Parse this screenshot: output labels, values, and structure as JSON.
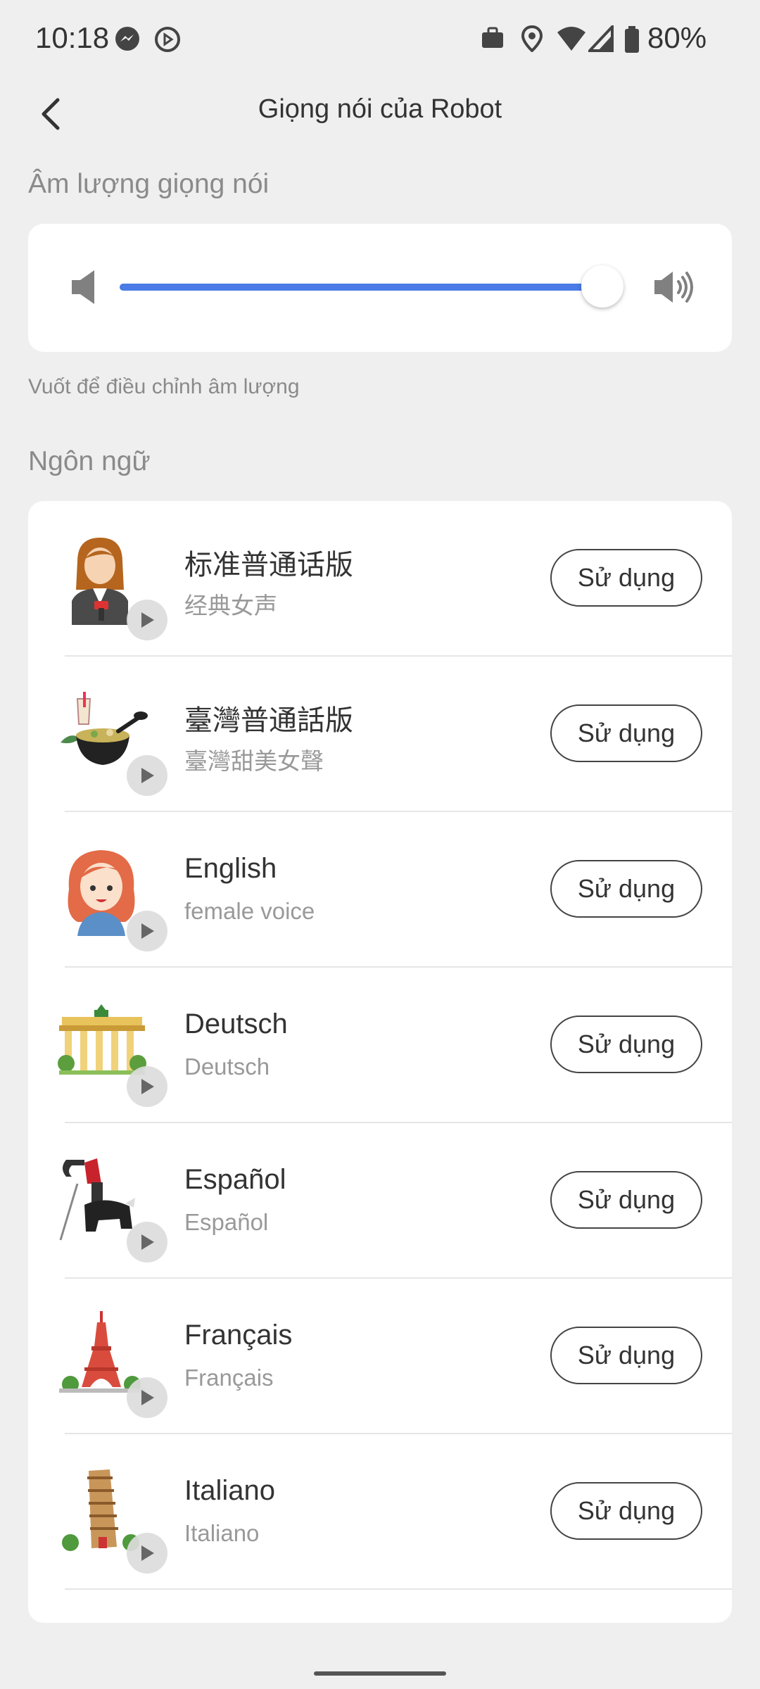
{
  "status_bar": {
    "time": "10:18",
    "battery": "80%",
    "icons": [
      "messenger-icon",
      "screen-record-icon",
      "work-profile-icon",
      "location-icon",
      "wifi-icon",
      "signal-icon",
      "battery-icon"
    ]
  },
  "header": {
    "title": "Giọng nói của Robot",
    "back_icon": "back-arrow-icon"
  },
  "volume": {
    "section_label": "Âm lượng giọng nói",
    "level": 0.98,
    "hint": "Vuốt để điều chỉnh âm lượng",
    "accent_color": "#4a7be6"
  },
  "languages": {
    "section_label": "Ngôn ngữ",
    "items": [
      {
        "name": "标准普通话版",
        "subtitle": "经典女声",
        "button": "Sử dụng",
        "icon": "news-anchor-avatar-icon"
      },
      {
        "name": "臺灣普通話版",
        "subtitle": "臺灣甜美女聲",
        "button": "Sử dụng",
        "icon": "taiwanese-food-icon"
      },
      {
        "name": "English",
        "subtitle": "female voice",
        "button": "Sử dụng",
        "icon": "redhead-girl-avatar-icon"
      },
      {
        "name": "Deutsch",
        "subtitle": "Deutsch",
        "button": "Sử dụng",
        "icon": "brandenburg-gate-icon"
      },
      {
        "name": "Español",
        "subtitle": "Español",
        "button": "Sử dụng",
        "icon": "bullfighter-icon"
      },
      {
        "name": "Français",
        "subtitle": "Français",
        "button": "Sử dụng",
        "icon": "eiffel-tower-icon"
      },
      {
        "name": "Italiano",
        "subtitle": "Italiano",
        "button": "Sử dụng",
        "icon": "leaning-tower-pisa-icon"
      }
    ]
  }
}
